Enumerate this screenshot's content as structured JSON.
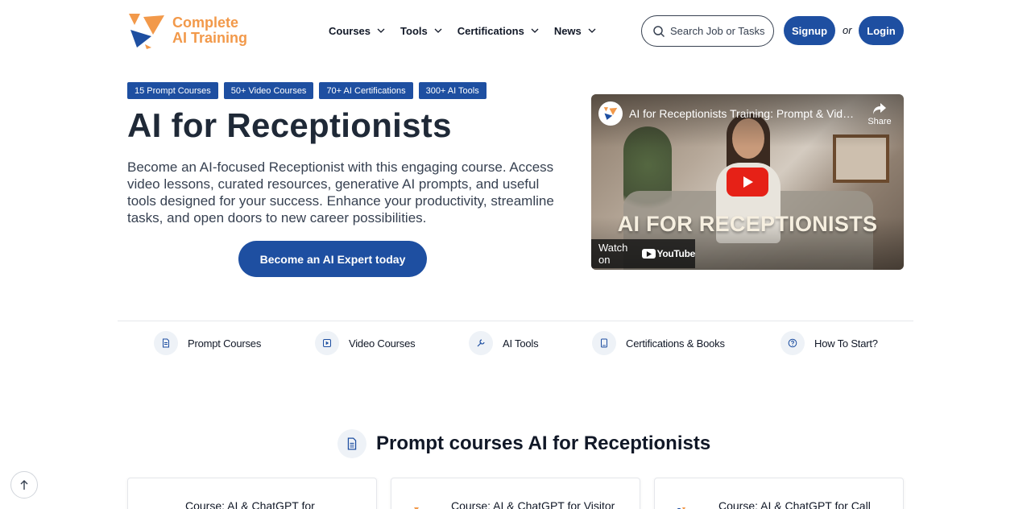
{
  "header": {
    "logo_line1": "Complete",
    "logo_line2": "AI Training",
    "nav": [
      {
        "label": "Courses"
      },
      {
        "label": "Tools"
      },
      {
        "label": "Certifications"
      },
      {
        "label": "News"
      }
    ],
    "search_placeholder": "Search Job or Tasks",
    "signup_label": "Signup",
    "or_label": "or",
    "login_label": "Login"
  },
  "hero": {
    "badges": [
      "15 Prompt Courses",
      "50+ Video Courses",
      "70+ AI Certifications",
      "300+ AI Tools"
    ],
    "title": "AI for Receptionists",
    "description": "Become an AI-focused Receptionist with this engaging course. Access video lessons, curated resources, generative AI prompts, and useful tools designed for your success. Enhance your productivity, streamline tasks, and open doors to new career possibilities.",
    "cta_label": "Become an AI Expert today"
  },
  "video": {
    "title": "AI for Receptionists Training: Prompt & Video ...",
    "share_label": "Share",
    "overlay_text": "AI FOR RECEPTIONISTS",
    "watch_on": "Watch on",
    "youtube_label": "YouTube"
  },
  "categories": [
    {
      "label": "Prompt Courses",
      "icon": "document-icon"
    },
    {
      "label": "Video Courses",
      "icon": "play-icon"
    },
    {
      "label": "AI Tools",
      "icon": "wrench-icon"
    },
    {
      "label": "Certifications & Books",
      "icon": "book-icon"
    },
    {
      "label": "How To Start?",
      "icon": "question-icon"
    }
  ],
  "section": {
    "title": "Prompt courses AI for Receptionists"
  },
  "cards": [
    {
      "title": "Course: AI & ChatGPT for"
    },
    {
      "title": "Course: AI & ChatGPT for Visitor"
    },
    {
      "title": "Course: AI & ChatGPT for Call"
    }
  ],
  "colors": {
    "brand_blue": "#1e4fa1",
    "logo_orange": "#f2994a",
    "youtube_red": "#e62117"
  }
}
